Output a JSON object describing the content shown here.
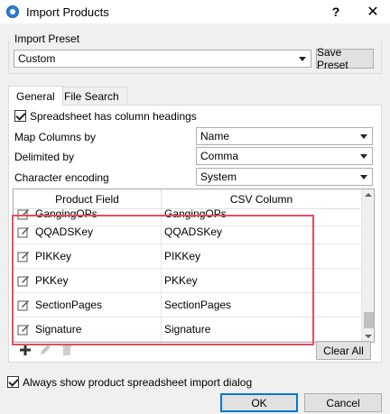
{
  "window": {
    "title": "Import Products",
    "help_label": "?",
    "close_label": "✕"
  },
  "preset": {
    "group_label": "Import Preset",
    "selected": "Custom",
    "save_label": "Save Preset"
  },
  "tabs": [
    {
      "label": "General",
      "active": true
    },
    {
      "label": "File Search",
      "active": false
    }
  ],
  "general": {
    "has_headings_label": "Spreadsheet has column headings",
    "map_columns_label": "Map Columns by",
    "map_columns_value": "Name",
    "delimited_label": "Delimited by",
    "delimited_value": "Comma",
    "encoding_label": "Character encoding",
    "encoding_value": "System"
  },
  "table": {
    "headers": [
      "Product Field",
      "CSV Column"
    ],
    "rows": [
      {
        "field": "GangingOPs",
        "csv": "GangingOPs"
      },
      {
        "field": "QQADSKey",
        "csv": "QQADSKey"
      },
      {
        "field": "PIKKey",
        "csv": "PIKKey"
      },
      {
        "field": "PKKey",
        "csv": "PKKey"
      },
      {
        "field": "SectionPages",
        "csv": "SectionPages"
      },
      {
        "field": "Signature",
        "csv": "Signature"
      }
    ],
    "icon": "edit-icon"
  },
  "toolbar": {
    "add_icon": "plus-icon",
    "edit_icon": "pencil-icon",
    "delete_icon": "trash-icon",
    "clear_label": "Clear All"
  },
  "footer": {
    "always_show_label": "Always show product spreadsheet import dialog",
    "ok_label": "OK",
    "cancel_label": "Cancel"
  },
  "colors": {
    "highlight": "#e05060",
    "accent": "#0078d7"
  }
}
